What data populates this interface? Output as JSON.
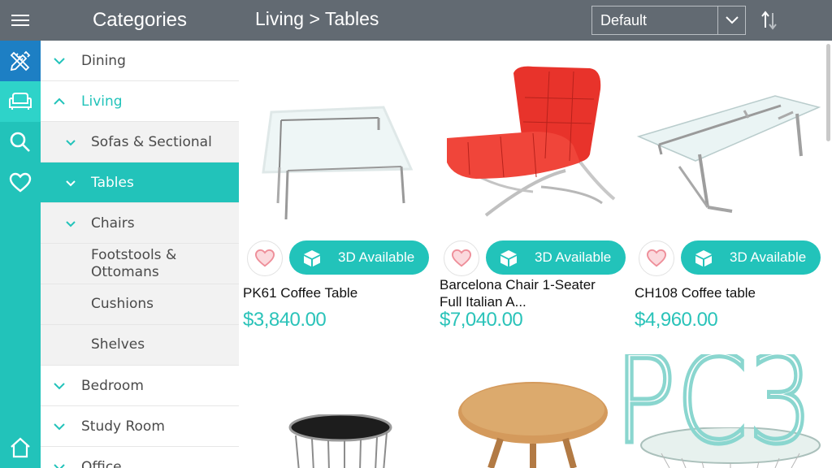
{
  "sidebar_header": "Categories",
  "categories": [
    {
      "label": "Dining",
      "level": 1,
      "state": "collapsed"
    },
    {
      "label": "Living",
      "level": 1,
      "state": "expanded"
    },
    {
      "label": "Sofas & Sectional",
      "level": 2,
      "state": "collapsed"
    },
    {
      "label": "Tables",
      "level": 2,
      "state": "active"
    },
    {
      "label": "Chairs",
      "level": 2,
      "state": "collapsed"
    },
    {
      "label": "Footstools &",
      "label2": "Ottomans",
      "level": 3
    },
    {
      "label": "Cushions",
      "level": 3
    },
    {
      "label": "Shelves",
      "level": 3
    },
    {
      "label": "Bedroom",
      "level": 1,
      "state": "collapsed"
    },
    {
      "label": "Study Room",
      "level": 1,
      "state": "collapsed"
    },
    {
      "label": "Office",
      "level": 1,
      "state": "collapsed"
    }
  ],
  "breadcrumb": "Living > Tables",
  "sort": {
    "selected": "Default"
  },
  "products": [
    {
      "name": "PK61 Coffee Table",
      "price": "$3,840.00",
      "badge": "3D Available"
    },
    {
      "name": "Barcelona Chair 1-Seater",
      "name2": "Full Italian A...",
      "price": "$7,040.00",
      "badge": "3D Available"
    },
    {
      "name": "CH108 Coffee table",
      "price": "$4,960.00",
      "badge": "3D Available"
    }
  ],
  "watermark": "PC3",
  "icons": {
    "menu": "hamburger-icon",
    "design": "pencil-ruler-icon",
    "catalog": "sofa-icon",
    "search": "search-icon",
    "favorites": "heart-icon",
    "home": "home-icon"
  },
  "colors": {
    "accent": "#22c3ba",
    "header": "#626a72",
    "price": "#2ac3b9",
    "design_active": "#1d7fc4"
  }
}
